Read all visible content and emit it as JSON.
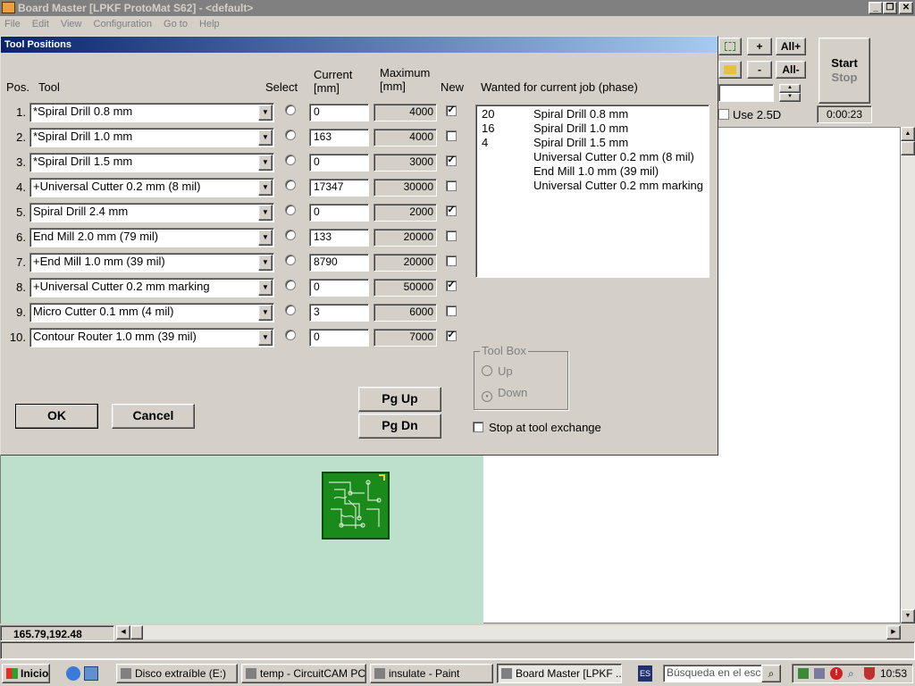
{
  "app": {
    "title": "Board Master [LPKF ProtoMat S62]  - <default>",
    "menu": [
      "File",
      "Edit",
      "View",
      "Configuration",
      "Go to",
      "Help"
    ]
  },
  "toolbar": {
    "plus": "+",
    "all_plus": "All+",
    "minus": "-",
    "all_minus": "All-",
    "start": "Start",
    "stop": "Stop",
    "use_label": "Use 2.5D",
    "timer": "0:00:23"
  },
  "dialog": {
    "title": "Tool Positions",
    "headers": {
      "pos": "Pos.",
      "tool": "Tool",
      "select": "Select",
      "current": "Current\n[mm]",
      "current_line1": "Current",
      "current_line2": "[mm]",
      "maximum_line1": "Maximum",
      "maximum_line2": "[mm]",
      "new": "New",
      "wanted": "Wanted for current job (phase)"
    },
    "rows": [
      {
        "pos": "1.",
        "tool": "*Spiral Drill 0.8 mm",
        "current": "0",
        "maximum": "4000",
        "new": true
      },
      {
        "pos": "2.",
        "tool": "*Spiral Drill 1.0 mm",
        "current": "163",
        "maximum": "4000",
        "new": false
      },
      {
        "pos": "3.",
        "tool": "*Spiral Drill 1.5 mm",
        "current": "0",
        "maximum": "3000",
        "new": true
      },
      {
        "pos": "4.",
        "tool": "+Universal Cutter 0.2 mm (8 mil)",
        "current": "17347",
        "maximum": "30000",
        "new": false
      },
      {
        "pos": "5.",
        "tool": "Spiral Drill 2.4 mm",
        "current": "0",
        "maximum": "2000",
        "new": true
      },
      {
        "pos": "6.",
        "tool": "End Mill 2.0 mm (79 mil)",
        "current": "133",
        "maximum": "20000",
        "new": false
      },
      {
        "pos": "7.",
        "tool": "+End Mill 1.0 mm (39 mil)",
        "current": "8790",
        "maximum": "20000",
        "new": false
      },
      {
        "pos": "8.",
        "tool": "+Universal Cutter 0.2 mm marking",
        "current": "0",
        "maximum": "50000",
        "new": true
      },
      {
        "pos": "9.",
        "tool": "Micro Cutter 0.1 mm (4 mil)",
        "current": "3",
        "maximum": "6000",
        "new": false
      },
      {
        "pos": "10.",
        "tool": "Contour Router 1.0 mm (39 mil)",
        "current": "0",
        "maximum": "7000",
        "new": true
      }
    ],
    "wanted": [
      {
        "qty": "20",
        "tool": "Spiral Drill 0.8 mm"
      },
      {
        "qty": "16",
        "tool": "Spiral Drill 1.0 mm"
      },
      {
        "qty": "4",
        "tool": "Spiral Drill 1.5 mm"
      },
      {
        "qty": "",
        "tool": "Universal Cutter 0.2 mm (8 mil)"
      },
      {
        "qty": "",
        "tool": "End Mill 1.0 mm (39 mil)"
      },
      {
        "qty": "",
        "tool": "Universal Cutter 0.2 mm marking"
      }
    ],
    "buttons": {
      "ok": "OK",
      "cancel": "Cancel",
      "pg_up": "Pg Up",
      "pg_dn": "Pg Dn"
    },
    "toolbox": {
      "legend": "Tool Box",
      "up": "Up",
      "down": "Down",
      "selected": "Down"
    },
    "stop_at_exchange": {
      "label": "Stop at tool exchange",
      "checked": false
    }
  },
  "status": {
    "coords": "165.79,192.48"
  },
  "taskbar": {
    "start": "Inicio",
    "tasks": [
      {
        "label": "Disco extraíble (E:)",
        "active": false
      },
      {
        "label": "temp - CircuitCAM PCB",
        "active": false
      },
      {
        "label": "insulate - Paint",
        "active": false
      },
      {
        "label": "Board Master [LPKF ...",
        "active": true
      }
    ],
    "lang": "ES",
    "search_placeholder": "Búsqueda en el escrit",
    "clock": "10:53"
  },
  "colors": {
    "dialog_title_start": "#0a246a",
    "dialog_title_end": "#a6caf0",
    "board": "#bde0cc",
    "pcb": "#1a8a1a"
  }
}
